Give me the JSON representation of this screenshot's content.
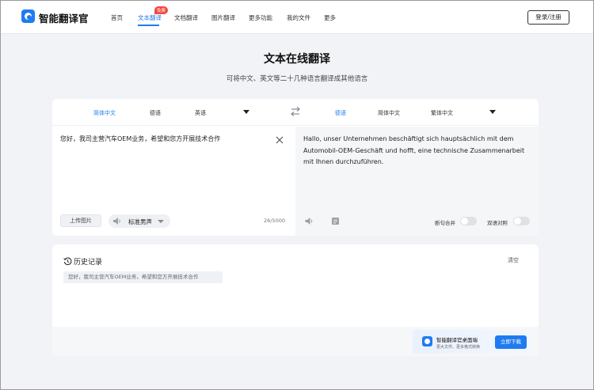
{
  "header": {
    "brand": "智能翻译官",
    "nav": [
      "首页",
      "文本翻译",
      "文档翻译",
      "图片翻译",
      "更多功能",
      "我的文件",
      "更多"
    ],
    "active_nav": "文本翻译",
    "badge": "免费",
    "login_label": "登录/注册"
  },
  "hero": {
    "title": "文本在线翻译",
    "subtitle": "可将中文、英文等二十几种语言翻译成其他语言"
  },
  "languages": {
    "source": [
      "简体中文",
      "德语",
      "英语"
    ],
    "target": [
      "德语",
      "简体中文",
      "繁体中文"
    ],
    "active_source": "简体中文",
    "active_target": "德语"
  },
  "source": {
    "text": "您好，我司主营汽车OEM业务，希望和您方开展技术合作",
    "upload_label": "上传图片",
    "voice_label": "标准男声",
    "char_count": "26/5000"
  },
  "target": {
    "text": "Hallo, unser Unternehmen beschäftigt sich hauptsächlich mit dem Automobil-OEM-Geschäft und hofft, eine technische Zusammenarbeit mit Ihnen durchzuführen.",
    "toggle_sentence_merge": "断句合并",
    "toggle_bilingual": "双语对照"
  },
  "history": {
    "title": "历史记录",
    "clear_label": "清空",
    "items": [
      "您好，我司主营汽车OEM业务，希望和您方开展技术合作"
    ]
  },
  "promo": {
    "title": "智能翻译官桌面端",
    "subtitle": "更大文件、更多格式转换",
    "download_label": "立即下载"
  },
  "colors": {
    "accent": "#1f7cf0",
    "badge": "#f2493d"
  }
}
